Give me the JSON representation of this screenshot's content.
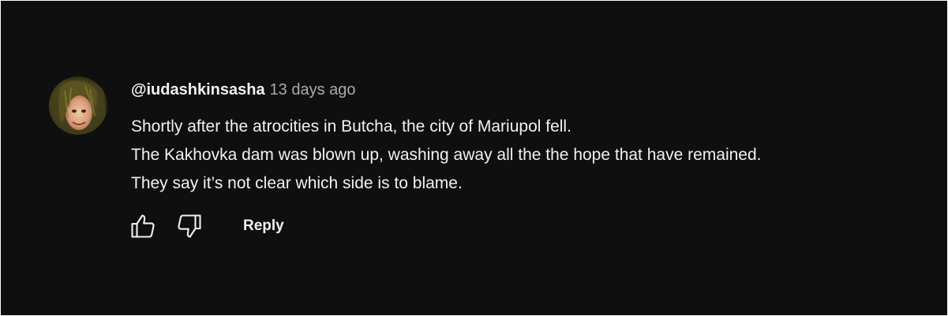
{
  "comment": {
    "author": "@iudashkinsasha",
    "time": "13 days ago",
    "lines": [
      "Shortly after the atrocities in Butcha, the city of Mariupol fell.",
      "The Kakhovka dam was blown up, washing away all the the hope that have remained.",
      "They say it’s not clear which side is to blame."
    ],
    "avatar_icon": "user-avatar-photo"
  },
  "actions": {
    "like_icon": "thumbs-up-icon",
    "dislike_icon": "thumbs-down-icon",
    "reply_label": "Reply"
  },
  "colors": {
    "background": "#0f0f0f",
    "text_primary": "#f1f1f1",
    "text_secondary": "#aaaaaa"
  }
}
